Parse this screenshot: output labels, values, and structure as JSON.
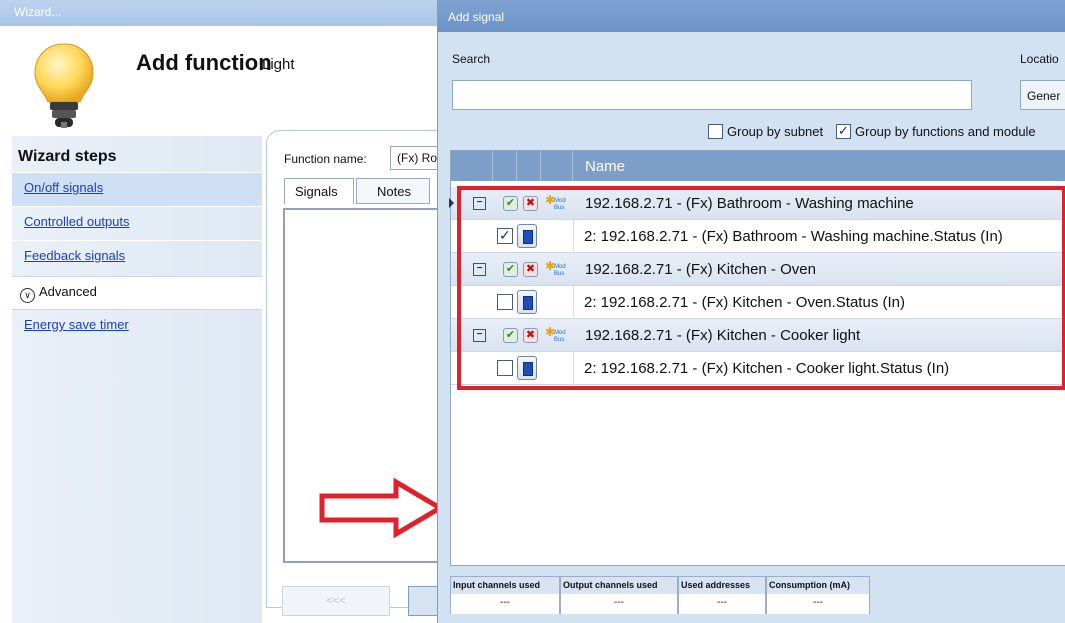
{
  "wizard": {
    "window_title": "Wizard...",
    "title": "Add function",
    "subtitle": "Light",
    "steps_title": "Wizard steps",
    "steps": [
      {
        "label": "On/off signals",
        "active": true
      },
      {
        "label": "Controlled outputs",
        "active": false
      },
      {
        "label": "Feedback signals",
        "active": false
      }
    ],
    "advanced_label": "Advanced",
    "advanced_steps": [
      {
        "label": "Energy save timer"
      }
    ],
    "function_name_label": "Function name:",
    "function_name_value": "(Fx) Ro",
    "tabs": [
      "Signals",
      "Notes"
    ],
    "back_button": "<<<"
  },
  "dialog": {
    "title": "Add signal",
    "search_label": "Search",
    "search_value": "",
    "location_label": "Locatio",
    "location_value": "Gener",
    "group_by_subnet": {
      "label": "Group by subnet",
      "checked": false
    },
    "group_by_functions": {
      "label": "Group by functions and module",
      "checked": true
    },
    "grid": {
      "column_name": "Name",
      "rows": [
        {
          "type": "group",
          "text": "192.168.2.71 - (Fx) Bathroom - Washing machine",
          "module": "Mod Bus"
        },
        {
          "type": "child",
          "text": "2: 192.168.2.71 - (Fx) Bathroom - Washing machine.Status (In)",
          "checked": true
        },
        {
          "type": "group",
          "text": "192.168.2.71 - (Fx) Kitchen - Oven",
          "module": "Mod Bus"
        },
        {
          "type": "child",
          "text": "2: 192.168.2.71 - (Fx) Kitchen - Oven.Status (In)",
          "checked": false
        },
        {
          "type": "group",
          "text": "192.168.2.71 - (Fx) Kitchen - Cooker light",
          "module": "Mod Bus"
        },
        {
          "type": "child",
          "text": "2: 192.168.2.71 - (Fx) Kitchen - Cooker light.Status (In)",
          "checked": false
        }
      ]
    },
    "summary": {
      "headers": [
        "Input channels used",
        "Output channels used",
        "Used addresses",
        "Consumption (mA)"
      ],
      "values": [
        "---",
        "---",
        "---",
        "---"
      ]
    }
  },
  "colors": {
    "highlight": "#e0202a",
    "dialog_bg": "#d3e2f3",
    "grid_header": "#7d9ec8"
  }
}
